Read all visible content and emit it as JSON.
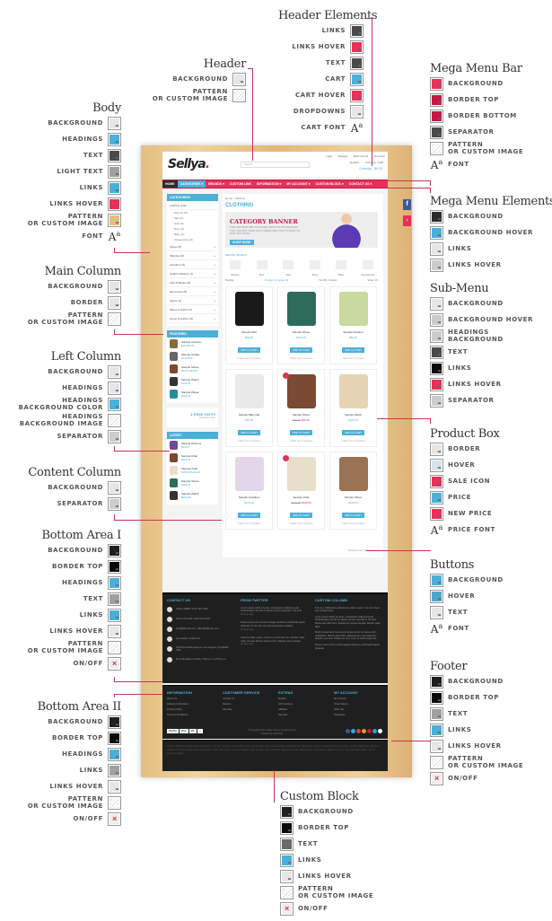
{
  "colors": {
    "pink": "#e8305a",
    "crimson": "#c51843",
    "blue": "#4bb0d8",
    "dark": "#4a4a4a",
    "light": "#e6e6e6",
    "grey": "#a0a0a0",
    "lightgrey": "#cccccc",
    "black": "#0a0a0a",
    "charcoal": "#1f1f1f",
    "mid": "#6a6a6a",
    "tan": "#e5be82",
    "paleblue": "#d6e3ec"
  },
  "groups": {
    "header_elements": {
      "title": "Header Elements",
      "items": [
        {
          "label": "Links",
          "type": "color",
          "color": "#4a4a4a"
        },
        {
          "label": "Links Hover",
          "type": "color",
          "color": "#e8305a"
        },
        {
          "label": "Text",
          "type": "color",
          "color": "#4a4a4a"
        },
        {
          "label": "Cart",
          "type": "color",
          "color": "#4bb0d8"
        },
        {
          "label": "Cart Hover",
          "type": "color",
          "color": "#e8305a"
        },
        {
          "label": "Dropdowns",
          "type": "color",
          "color": "#e6e6e6"
        },
        {
          "label": "Cart Font",
          "type": "font"
        }
      ]
    },
    "header": {
      "title": "Header",
      "items": [
        {
          "label": "Background",
          "type": "color",
          "color": "#e6e6e6"
        },
        {
          "label": "Pattern|or Custom Image",
          "type": "pattern"
        }
      ]
    },
    "body": {
      "title": "Body",
      "items": [
        {
          "label": "Background",
          "type": "color",
          "color": "#e6e6e6"
        },
        {
          "label": "Headings",
          "type": "color",
          "color": "#4bb0d8"
        },
        {
          "label": "Text",
          "type": "color",
          "color": "#4a4a4a"
        },
        {
          "label": "Light Text",
          "type": "color",
          "color": "#a0a0a0"
        },
        {
          "label": "Links",
          "type": "color",
          "color": "#4bb0d8"
        },
        {
          "label": "Links Hover",
          "type": "color",
          "color": "#e8305a"
        },
        {
          "label": "Pattern|or Custom Image",
          "type": "color",
          "color": "#e5be82"
        },
        {
          "label": "Font",
          "type": "font"
        }
      ]
    },
    "main_column": {
      "title": "Main Column",
      "items": [
        {
          "label": "Background",
          "type": "color",
          "color": "#e6e6e6"
        },
        {
          "label": "Border",
          "type": "color",
          "color": "#e6e6e6"
        },
        {
          "label": "Pattern|or Custom Image",
          "type": "pattern"
        }
      ]
    },
    "left_column": {
      "title": "Left Column",
      "items": [
        {
          "label": "Background",
          "type": "color",
          "color": "#e6e6e6"
        },
        {
          "label": "Headings",
          "type": "color",
          "color": "#e6e6e6"
        },
        {
          "label": "Headings|Background Color",
          "type": "color",
          "color": "#4bb0d8"
        },
        {
          "label": "Headings|Background Image",
          "type": "pattern"
        },
        {
          "label": "Separator",
          "type": "color",
          "color": "#cccccc"
        }
      ]
    },
    "content_column": {
      "title": "Content Column",
      "items": [
        {
          "label": "Background",
          "type": "color",
          "color": "#e6e6e6"
        },
        {
          "label": "Separator",
          "type": "color",
          "color": "#cccccc"
        }
      ]
    },
    "bottom_area_1": {
      "title": "Bottom Area I",
      "items": [
        {
          "label": "Background",
          "type": "color",
          "color": "#1f1f1f"
        },
        {
          "label": "Border Top",
          "type": "color",
          "color": "#0a0a0a"
        },
        {
          "label": "Headings",
          "type": "color",
          "color": "#4bb0d8"
        },
        {
          "label": "Text",
          "type": "color",
          "color": "#a0a0a0"
        },
        {
          "label": "Links",
          "type": "color",
          "color": "#4bb0d8"
        },
        {
          "label": "Links Hover",
          "type": "color",
          "color": "#e6e6e6"
        },
        {
          "label": "Pattern|or Custom Image",
          "type": "pattern"
        },
        {
          "label": "On/Off",
          "type": "toggle"
        }
      ]
    },
    "bottom_area_2": {
      "title": "Bottom Area II",
      "items": [
        {
          "label": "Background",
          "type": "color",
          "color": "#1f1f1f"
        },
        {
          "label": "Border Top",
          "type": "color",
          "color": "#0a0a0a"
        },
        {
          "label": "Headings",
          "type": "color",
          "color": "#4bb0d8"
        },
        {
          "label": "Links",
          "type": "color",
          "color": "#a0a0a0"
        },
        {
          "label": "Links Hover",
          "type": "color",
          "color": "#e6e6e6"
        },
        {
          "label": "Pattern|or Custom Image",
          "type": "pattern"
        },
        {
          "label": "On/Off",
          "type": "toggle"
        }
      ]
    },
    "mega_menu_bar": {
      "title": "Mega Menu Bar",
      "items": [
        {
          "label": "Background",
          "type": "color",
          "color": "#e8305a"
        },
        {
          "label": "Border Top",
          "type": "color",
          "color": "#c51843"
        },
        {
          "label": "Border Bottom",
          "type": "color",
          "color": "#c51843"
        },
        {
          "label": "Separator",
          "type": "color",
          "color": "#4a4a4a"
        },
        {
          "label": "Pattern|or Custom Image",
          "type": "pattern"
        },
        {
          "label": "Font",
          "type": "font"
        }
      ]
    },
    "mega_menu_elements": {
      "title": "Mega Menu Elements",
      "items": [
        {
          "label": "Background",
          "type": "color",
          "color": "#2c2c2c"
        },
        {
          "label": "Background Hover",
          "type": "color",
          "color": "#4bb0d8"
        },
        {
          "label": "Links",
          "type": "color",
          "color": "#e6e6e6"
        },
        {
          "label": "Links Hover",
          "type": "color",
          "color": "#cccccc"
        }
      ]
    },
    "sub_menu": {
      "title": "Sub-Menu",
      "items": [
        {
          "label": "Background",
          "type": "color",
          "color": "#e6e6e6"
        },
        {
          "label": "Background Hover",
          "type": "color",
          "color": "#cccccc"
        },
        {
          "label": "Headings|Background",
          "type": "color",
          "color": "#cccccc"
        },
        {
          "label": "Text",
          "type": "color",
          "color": "#4a4a4a"
        },
        {
          "label": "Links",
          "type": "color",
          "color": "#0a0a0a"
        },
        {
          "label": "Links Hover",
          "type": "color",
          "color": "#e8305a"
        },
        {
          "label": "Separator",
          "type": "color",
          "color": "#cccccc"
        }
      ]
    },
    "product_box": {
      "title": "Product Box",
      "items": [
        {
          "label": "Border",
          "type": "color",
          "color": "#e6e6e6"
        },
        {
          "label": "Hover",
          "type": "color",
          "color": "#d6e3ec"
        },
        {
          "label": "Sale Icon",
          "type": "color",
          "color": "#e8305a"
        },
        {
          "label": "Price",
          "type": "color",
          "color": "#4bb0d8"
        },
        {
          "label": "New Price",
          "type": "color",
          "color": "#e8305a"
        },
        {
          "label": "Price Font",
          "type": "font"
        }
      ]
    },
    "buttons": {
      "title": "Buttons",
      "items": [
        {
          "label": "Background",
          "type": "color",
          "color": "#4bb0d8"
        },
        {
          "label": "Hover",
          "type": "color",
          "color": "#4ba8cc"
        },
        {
          "label": "Text",
          "type": "color",
          "color": "#e6e6e6"
        },
        {
          "label": "Font",
          "type": "font"
        }
      ]
    },
    "footer": {
      "title": "Footer",
      "items": [
        {
          "label": "Background",
          "type": "color",
          "color": "#1f1f1f"
        },
        {
          "label": "Border Top",
          "type": "color",
          "color": "#0a0a0a"
        },
        {
          "label": "Text",
          "type": "color",
          "color": "#a0a0a0"
        },
        {
          "label": "Links",
          "type": "color",
          "color": "#4bb0d8"
        },
        {
          "label": "Links Hover",
          "type": "color",
          "color": "#e6e6e6"
        },
        {
          "label": "Pattern|or Custom Image",
          "type": "pattern"
        },
        {
          "label": "On/Off",
          "type": "toggle"
        }
      ]
    },
    "custom_block": {
      "title": "Custom Block",
      "items": [
        {
          "label": "Background",
          "type": "color",
          "color": "#1f1f1f"
        },
        {
          "label": "Border Top",
          "type": "color",
          "color": "#0a0a0a"
        },
        {
          "label": "Text",
          "type": "color",
          "color": "#6a6a6a"
        },
        {
          "label": "Links",
          "type": "color",
          "color": "#4bb0d8"
        },
        {
          "label": "Links Hover",
          "type": "color",
          "color": "#e6e6e6"
        },
        {
          "label": "Pattern|or Custom Image",
          "type": "pattern"
        },
        {
          "label": "On/Off",
          "type": "toggle"
        }
      ]
    }
  },
  "font_glyph": "Aa",
  "toggle_glyph": "×",
  "site": {
    "logo": "Sellya",
    "logo_dot": ".",
    "search_placeholder": "Search",
    "top_links": [
      "Login",
      "Register",
      "Wish List (0)",
      "Checkout"
    ],
    "language": "English",
    "currency": "Currency: USD",
    "cart": "0 item(s) - $0.00",
    "menu": [
      "HOME",
      "CATEGORIES ▾",
      "BRANDS ▾",
      "CUSTOM LINK",
      "INFORMATION ▾",
      "MY ACCOUNT ▾",
      "CUSTOM BLOCK ▾",
      "CONTACT US ▾"
    ],
    "categories_heading": "CATEGORIES",
    "categories": [
      {
        "name": "Clothing (110)",
        "toggle": "−",
        "subs": [
          "Women (8)",
          "Men (0)",
          "Girls (0)",
          "Boys (0)",
          "Baby (2)",
          "Accessories (0)"
        ]
      },
      {
        "name": "Shoes (8)",
        "toggle": "+"
      },
      {
        "name": "Watches (8)",
        "toggle": "+"
      },
      {
        "name": "Jewellery (5)",
        "toggle": "+"
      },
      {
        "name": "Health & Beauty (4)",
        "toggle": "+"
      },
      {
        "name": "Kids & Babies (8)",
        "toggle": "+"
      },
      {
        "name": "Electronics (8)",
        "toggle": "+"
      },
      {
        "name": "Sports (3)",
        "toggle": "+"
      },
      {
        "name": "Wines & Spirits (3)",
        "toggle": "+"
      },
      {
        "name": "Home & Garden (8)",
        "toggle": "+"
      }
    ],
    "featured_heading": "FEATURED",
    "featured": [
      {
        "name": "Sample Camera",
        "price": "$25,999.00"
      },
      {
        "name": "Sample Stroller",
        "price": "$1,299.00"
      },
      {
        "name": "Sample Shoes",
        "price": "$89.00 $85.00"
      },
      {
        "name": "Sample Watch",
        "price": "$129.00"
      },
      {
        "name": "Sample Player",
        "price": "$198.00"
      }
    ],
    "gifts": "2 FREE GIFTS",
    "gifts_sub": "and many more!",
    "latest_heading": "LATEST",
    "latest": [
      {
        "name": "Sample Perfume",
        "price": "$89.00"
      },
      {
        "name": "Sample Chair",
        "price": "$829.00"
      },
      {
        "name": "Sample Chair",
        "price": "$139.00 $129.00"
      },
      {
        "name": "Sample Shoes",
        "price": "$199.00"
      },
      {
        "name": "Sample Watch",
        "price": "$669.00"
      }
    ],
    "breadcrumb": "Home › Clothing",
    "page_title": "CLOTHING",
    "banner_title": "CATEGORY BANNER",
    "banner_text": "THIS BANNER ARE INCLUDED WITH YOUR PURCHASE. YOU CAN PUT YOUR OWN IMAGE AND TEXT IN EASY TO EDIT PSD FILES.",
    "banner_button": "SHOP NOW!",
    "refine": "REFINE SEARCH",
    "refine_cats": [
      "Women",
      "Men",
      "Girls",
      "Boys",
      "Baby",
      "Accessories"
    ],
    "display": "Display:",
    "compare": "Product Compare (0)",
    "sort": "Sort By: Default",
    "show": "Show: 15",
    "add_to_cart": "ADD TO CART",
    "wish": "♥ Wish List",
    "compare_link": "⇅ Compare",
    "products": [
      {
        "name": "Sample Shirt",
        "price": "$58.90",
        "img": "#1a1a1a"
      },
      {
        "name": "Sample Shoes",
        "price": "$199.00",
        "img": "#2f6b5a"
      },
      {
        "name": "Sample Perfume",
        "price": "$89.00",
        "img": "#c9d9a0"
      },
      {
        "name": "Sample Baby Hat",
        "price": "$36.90",
        "img": "#e9e9e9"
      },
      {
        "name": "Sample Shoes",
        "old": "$99.00",
        "new": "$89.00",
        "img": "#7a4a32",
        "sale": true
      },
      {
        "name": "Sample Watch",
        "price": "$109.00",
        "img": "#e6d4b5"
      },
      {
        "name": "Sample Jewellery",
        "price": "$129.00",
        "img": "#e3d6e8"
      },
      {
        "name": "Sample Chair",
        "old": "$139.00",
        "new": "$129.00",
        "img": "#e8dfcb",
        "sale": true
      },
      {
        "name": "Sample Shoes",
        "price": "$199.00",
        "img": "#9a7254"
      }
    ],
    "showing": "Showing 1 to 9 of 9 (1 Pages)",
    "contact_heading": "CONTACT US",
    "contacts": [
      "Call us FREE: 0123 123 1234",
      "0123 123 1234 / 0123 123 1234",
      "info@321cart.com / office@321cart.com",
      "your.sellya / sellya.info",
      "135 South Park Avenue / Los Angeles, CA 90024, USA",
      "From Monday to Friday / 9:00 a.m. to 5:00 p.m."
    ],
    "twitter_heading": "FROM TWITTER",
    "tweets": [
      "Lorem ipsum dolor sit amet, consectetur adipiscing elit. Pellentesque nisi dui at sapien tempor gravida in vel arcu.",
      "Donec porta enim sit amet augue iaculis eu sollicitudin ligula pharetra. Ut nec dui nec nisi consectetur sodales.",
      "Vivamus diam purus, cursus a, commodo non, facilisis vitae, nulla. Aenean dictum lacinia tortor. Aliquam erat volutpat."
    ],
    "tweet_time": "22 days ago",
    "custom_heading": "CUSTOM COLUMN",
    "custom_text": [
      "This is a CMS block edited from admin panel. You can insert any content here.",
      "Lorem ipsum dolor sit amet, consectetur adipiscing elit. Pellentesque nisi dui at sapien tempor gravida in vel arcu. Maecenas odio arcu, feugiat vel congue feugiat, laoreet vitae diam.",
      "Morbi consectetur nunc porta ligula tempor et varius nibh sollicitudin. Mauris risus felis, adipiscing eu consequat ac, aliquam vel urna. Nullam ac eros urna, at ullamcorper leo.",
      "Donec porta enim sit amet augue iaculis eu sollicitudin ligula pharetra."
    ],
    "footer_cols": [
      {
        "heading": "INFORMATION",
        "links": [
          "About Us",
          "Delivery Information",
          "Privacy Policy",
          "Terms & Conditions"
        ]
      },
      {
        "heading": "CUSTOMER SERVICE",
        "links": [
          "Contact Us",
          "Returns",
          "Site Map"
        ]
      },
      {
        "heading": "EXTRAS",
        "links": [
          "Brands",
          "Gift Vouchers",
          "Affiliates",
          "Specials"
        ]
      },
      {
        "heading": "MY ACCOUNT",
        "links": [
          "My Account",
          "Order History",
          "Wish List",
          "Newsletter"
        ]
      }
    ],
    "payments": [
      "PayPal",
      "VISA",
      "MC",
      "—"
    ],
    "copyright": "© Copyright 2012. Sellya Theme by 321cart.com",
    "powered": "Powered by OpenCart",
    "social": [
      "#3b5998",
      "#33a9dd",
      "#d7432f",
      "#f39330",
      "#c9182b",
      "#2aa4d5",
      "#ffffff"
    ],
    "custom_block_text": "This is a CMS block edited from admin panel. You can insert any content here. Lorem ipsum dolor sit amet, consectetur adipiscing elit. Pellentesque nisi dui at sapien tempor gravida in vel arcu. Maecenas odio arcu, feugiat vel congue feugiat, laoreet vitae diam. Morbi consectetur nunc porta ligula tempor et varius nibh sollicitudin. Mauris risus felis, adipiscing eu consequat ac, aliquam vel urna. Sed bibendum sapien nec leo egestas volutpat."
  }
}
